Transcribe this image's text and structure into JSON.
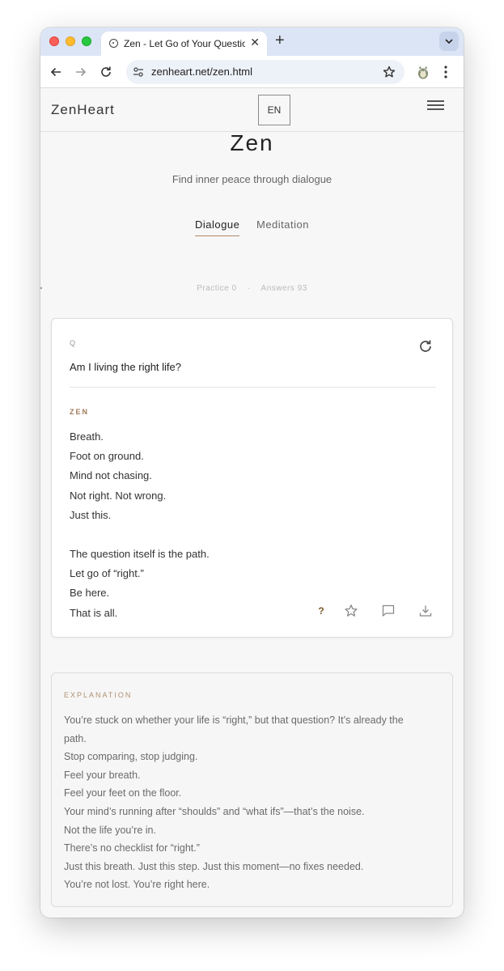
{
  "browser": {
    "tab_title": "Zen - Let Go of Your Question",
    "tab_close": "✕",
    "new_tab": "+",
    "url": "zenheart.net/zen.html"
  },
  "header": {
    "logo": "ZenHeart",
    "language_button": "EN"
  },
  "hero": {
    "title": "Zen",
    "subtitle": "Find inner peace through dialogue"
  },
  "mode_tabs": [
    {
      "label": "Dialogue",
      "active": true
    },
    {
      "label": "Meditation",
      "active": false
    }
  ],
  "stats": {
    "practice_label": "Practice",
    "practice_value": "0",
    "separator": "·",
    "answers_label": "Answers",
    "answers_value": "93"
  },
  "card": {
    "q_label": "Q",
    "question": "Am I living the right life?",
    "zen_label": "ZEN",
    "answer_lines": [
      "Breath.",
      "Foot on ground.",
      "Mind not chasing.",
      "Not right. Not wrong.",
      "Just this.",
      "",
      "The question itself is the path.",
      "Let go of “right.”",
      "Be here.",
      "That is all."
    ],
    "help_button": "?"
  },
  "explanation": {
    "label": "EXPLANATION",
    "lines": [
      "You’re stuck on whether your life is “right,” but that question? It’s already the",
      "path.",
      "Stop comparing, stop judging.",
      "Feel your breath.",
      "Feel your feet on the floor.",
      "Your mind’s running after “shoulds” and “what ifs”—that’s the noise.",
      "Not the life you’re in.",
      "There’s no checklist for “right.”",
      "Just this breath. Just this step. Just this moment—no fixes needed.",
      "You’re not lost. You’re right here."
    ]
  },
  "colors": {
    "accent": "#b08a6a",
    "zen_label": "#a07a5a",
    "tab_strip": "#dce5f5"
  }
}
